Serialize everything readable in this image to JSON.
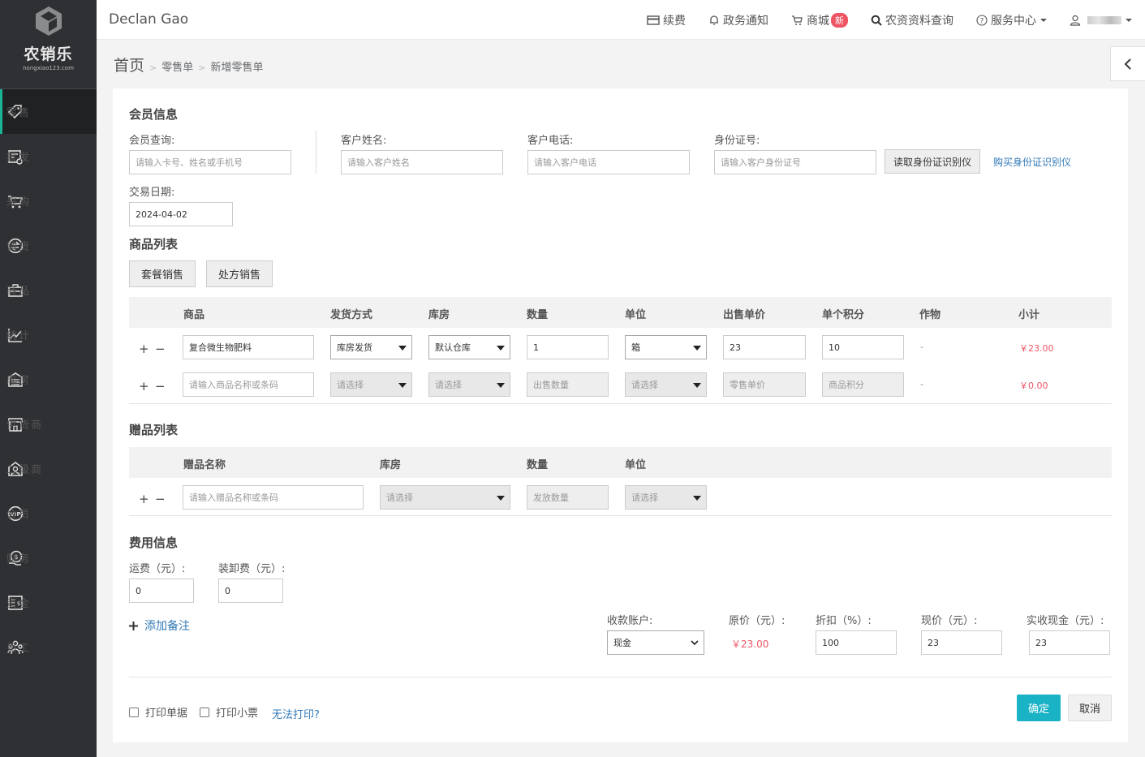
{
  "brand": {
    "name": "农销乐",
    "url": "nongxiao123.com"
  },
  "sidebar": {
    "items": [
      {
        "label": "零售",
        "icon": "tag-icon",
        "active": true
      },
      {
        "label": "批发",
        "icon": "wholesale-icon"
      },
      {
        "label": "采购",
        "icon": "cart-icon"
      },
      {
        "label": "调货",
        "icon": "transfer-icon"
      },
      {
        "label": "商品",
        "icon": "briefcase-icon"
      },
      {
        "label": "统计",
        "icon": "chart-icon"
      },
      {
        "label": "库房",
        "icon": "warehouse-icon"
      },
      {
        "label": "供货商",
        "icon": "store-icon"
      },
      {
        "label": "二级商",
        "icon": "dealer-icon"
      },
      {
        "label": "会员",
        "icon": "vip-icon"
      },
      {
        "label": "财务",
        "icon": "money-icon"
      },
      {
        "label": "资金",
        "icon": "ledger-icon"
      },
      {
        "label": "员工",
        "icon": "staff-icon"
      }
    ]
  },
  "header": {
    "username": "Declan Gao",
    "nav": {
      "renew": "续费",
      "notice": "政务通知",
      "mall": "商城",
      "mall_badge": "新",
      "query": "农资资料查询",
      "service": "服务中心"
    }
  },
  "breadcrumb": {
    "home": "首页",
    "level1": "零售单",
    "level2": "新增零售单"
  },
  "member": {
    "title": "会员信息",
    "search_label": "会员查询:",
    "search_placeholder": "请输入卡号、姓名或手机号",
    "name_label": "客户姓名:",
    "name_placeholder": "请输入客户姓名",
    "phone_label": "客户电话:",
    "phone_placeholder": "请输入客户电话",
    "id_label": "身份证号:",
    "id_placeholder": "请输入客户身份证号",
    "read_id_button": "读取身份证识别仪",
    "buy_id_link": "购买身份证识别仪",
    "date_label": "交易日期:",
    "date_value": "2024-04-02"
  },
  "products": {
    "title": "商品列表",
    "package_button": "套餐销售",
    "prescription_button": "处方销售",
    "headers": [
      "商品",
      "发货方式",
      "库房",
      "数量",
      "单位",
      "出售单价",
      "单个积分",
      "作物",
      "小计"
    ],
    "row1": {
      "product": "复合微生物肥料",
      "delivery": "库房发货",
      "warehouse": "默认仓库",
      "qty": "1",
      "unit": "箱",
      "price": "23",
      "points": "10",
      "crop": "-",
      "subtotal": "￥23.00"
    },
    "row2": {
      "product_ph": "请输入商品名称或条码",
      "delivery_ph": "请选择",
      "warehouse_ph": "请选择",
      "qty_ph": "出售数量",
      "unit_ph": "请选择",
      "price_ph": "零售单价",
      "points_ph": "商品积分",
      "crop": "-",
      "subtotal": "￥0.00"
    }
  },
  "gifts": {
    "title": "赠品列表",
    "headers": [
      "赠品名称",
      "库房",
      "数量",
      "单位"
    ],
    "row": {
      "name_ph": "请输入赠品名称或条码",
      "warehouse_ph": "请选择",
      "qty_ph": "发放数量",
      "unit_ph": "请选择"
    }
  },
  "fees": {
    "title": "费用信息",
    "freight_label": "运费（元）:",
    "freight_value": "0",
    "handling_label": "装卸费（元）:",
    "handling_value": "0",
    "add_note": "添加备注",
    "account_label": "收款账户:",
    "account_value": "现金",
    "original_label": "原价（元）:",
    "original_value": "￥23.00",
    "discount_label": "折扣（%）:",
    "discount_value": "100",
    "current_label": "现价（元）:",
    "current_value": "23",
    "cash_label": "实收现金（元）:",
    "cash_value": "23"
  },
  "footer": {
    "print_receipt": "打印单据",
    "print_ticket": "打印小票",
    "cant_print": "无法打印?",
    "confirm": "确定",
    "cancel": "取消"
  },
  "pm": {
    "plus": "+",
    "minus": "−"
  },
  "colors": {
    "accent": "#1ab3c5",
    "price": "#ed5565",
    "link": "#337ab7",
    "sidebar": "#2f3033"
  }
}
